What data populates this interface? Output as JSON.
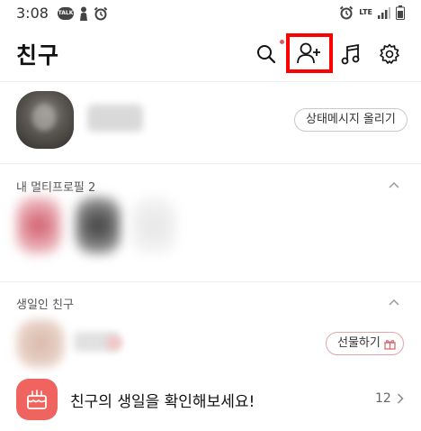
{
  "status_bar": {
    "time": "3:08",
    "talk_badge": "TALK",
    "network": "LTE"
  },
  "header": {
    "title": "친구"
  },
  "my_profile": {
    "status_message_button": "상태메시지 올리기"
  },
  "multi_profile": {
    "title": "내 멀티프로필 2"
  },
  "birthday_section": {
    "title": "생일인 친구",
    "gift_button": "선물하기"
  },
  "birthday_check": {
    "label": "친구의 생일을 확인해보세요!",
    "count": "12"
  },
  "colors": {
    "highlight_border": "#ff0000",
    "cake_tile": "#f0645f",
    "new_dot": "#e25a5a"
  },
  "icons": [
    "search-icon",
    "add-friend-icon",
    "music-icon",
    "gear-icon",
    "chevron-up-icon",
    "gift-icon",
    "cake-icon",
    "chevron-right-icon"
  ]
}
